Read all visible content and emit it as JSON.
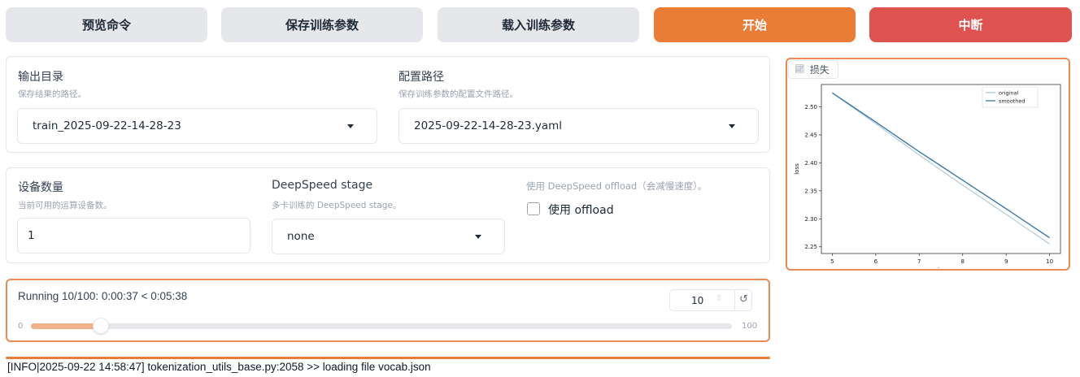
{
  "toolbar": {
    "preview_label": "预览命令",
    "save_label": "保存训练参数",
    "load_label": "载入训练参数",
    "start_label": "开始",
    "abort_label": "中断"
  },
  "output": {
    "output_dir_label": "输出目录",
    "output_dir_hint": "保存结果的路径。",
    "output_dir_value": "train_2025-09-22-14-28-23",
    "config_path_label": "配置路径",
    "config_path_hint": "保存训练参数的配置文件路径。",
    "config_path_value": "2025-09-22-14-28-23.yaml"
  },
  "devices": {
    "device_count_label": "设备数量",
    "device_count_hint": "当前可用的运算设备数。",
    "device_count_value": "1",
    "ds_stage_label": "DeepSpeed stage",
    "ds_stage_hint": "多卡训练的 DeepSpeed stage。",
    "ds_stage_value": "none",
    "ds_offload_hint": "使用 DeepSpeed offload（会减慢速度）。",
    "ds_offload_label": "使用 offload",
    "ds_offload_checked": false
  },
  "progress": {
    "status_text": "Running 10/100: 0:00:37 < 0:05:38",
    "value": "10",
    "min_label": "0",
    "max_label": "100",
    "fraction": 0.1
  },
  "log": {
    "line": "[INFO|2025-09-22 14:58:47] tokenization_utils_base.py:2058 >> loading file vocab.json"
  },
  "loss_chart": {
    "tab_label": "损失",
    "icon": "chart-icon"
  },
  "chart_data": {
    "type": "line",
    "title": "",
    "xlabel": "step",
    "ylabel": "loss",
    "x": [
      5,
      6,
      7,
      8,
      9,
      10
    ],
    "x_ticks": [
      "5",
      "6",
      "7",
      "8",
      "9",
      "10"
    ],
    "y_ticks": [
      "2.25",
      "2.30",
      "2.35",
      "2.40",
      "2.45",
      "2.50"
    ],
    "xlim": [
      4.75,
      10.25
    ],
    "ylim": [
      2.238,
      2.54
    ],
    "legend_position": "top-right",
    "series": [
      {
        "name": "original",
        "values": [
          2.525,
          2.47,
          2.414,
          2.36,
          2.308,
          2.255
        ],
        "color": "#a9c7d9"
      },
      {
        "name": "smoothed",
        "values": [
          2.525,
          2.473,
          2.42,
          2.369,
          2.318,
          2.266
        ],
        "color": "#3a79a6"
      }
    ]
  },
  "colors": {
    "accent_orange": "#ea7d36",
    "abort_red": "#de524f",
    "panel_border_orange": "#eb8a55"
  }
}
